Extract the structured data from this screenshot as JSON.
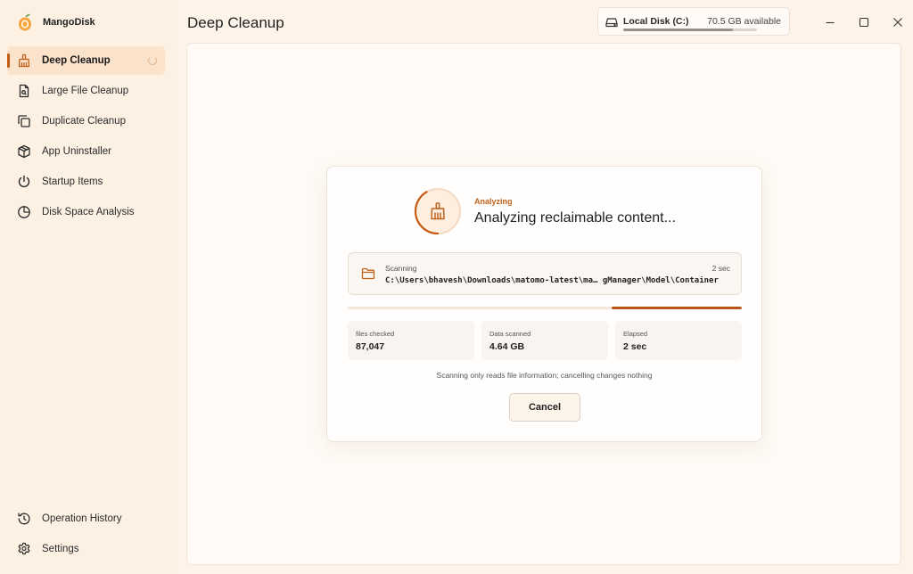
{
  "app": {
    "name": "MangoDisk",
    "accent_color": "#c55a12"
  },
  "sidebar": {
    "items": [
      {
        "label": "Deep Cleanup",
        "icon": "broom-icon",
        "active": true
      },
      {
        "label": "Large File Cleanup",
        "icon": "large-file-icon"
      },
      {
        "label": "Duplicate Cleanup",
        "icon": "duplicate-icon"
      },
      {
        "label": "App Uninstaller",
        "icon": "package-icon"
      },
      {
        "label": "Startup Items",
        "icon": "power-icon"
      },
      {
        "label": "Disk Space Analysis",
        "icon": "pie-chart-icon"
      }
    ],
    "bottom_items": [
      {
        "label": "Operation History",
        "icon": "history-icon"
      },
      {
        "label": "Settings",
        "icon": "gear-icon"
      }
    ]
  },
  "header": {
    "title": "Deep Cleanup"
  },
  "disk": {
    "name": "Local Disk (C:)",
    "available": "70.5 GB available",
    "used_fraction": 0.82
  },
  "window_controls": {
    "minimize": "minimize-icon",
    "maximize": "maximize-icon",
    "close": "close-icon"
  },
  "dialog": {
    "status_eyebrow": "Analyzing",
    "status_main": "Analyzing reclaimable content...",
    "scan": {
      "label": "Scanning",
      "time": "2 sec",
      "path": "C:\\Users\\bhavesh\\Downloads\\matomo-latest\\ma… gManager\\Model\\Container"
    },
    "progress": {
      "indeterminate": true,
      "segment_start": 0.67,
      "segment_end": 1.0
    },
    "stats": [
      {
        "label": "files checked",
        "value": "87,047"
      },
      {
        "label": "Data scanned",
        "value": "4.64 GB"
      },
      {
        "label": "Elapsed",
        "value": "2 sec"
      }
    ],
    "note": "Scanning only reads file information; cancelling changes nothing",
    "cancel_label": "Cancel"
  }
}
